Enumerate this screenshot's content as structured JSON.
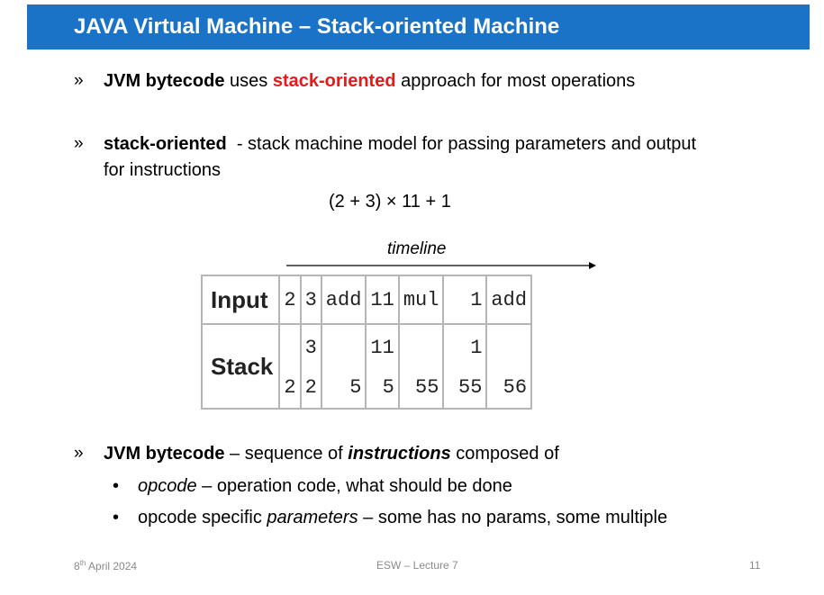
{
  "slide": {
    "title": "JAVA Virtual Machine – Stack-oriented Machine",
    "bullet_mark": "»",
    "sub_mark": "•",
    "bullet1": {
      "b1": "JVM bytecode",
      "t1": " uses ",
      "r1": "stack-oriented",
      "t2": " approach for most operations"
    },
    "bullet2": {
      "b1": "stack-oriented",
      "t1": "  - stack machine model for passing parameters and output",
      "line2": "for instructions"
    },
    "formula": "(2 + 3) × 11 + 1",
    "figure": {
      "timeline_label": "timeline",
      "row_input_label": "Input",
      "row_stack_label": "Stack",
      "columns": [
        {
          "input": "2",
          "stack_top": "",
          "stack_bottom": "2"
        },
        {
          "input": "3",
          "stack_top": "3",
          "stack_bottom": "2"
        },
        {
          "input": "add",
          "stack_top": "",
          "stack_bottom": "5"
        },
        {
          "input": "11",
          "stack_top": "11",
          "stack_bottom": "5"
        },
        {
          "input": "mul",
          "stack_top": "",
          "stack_bottom": "55"
        },
        {
          "input": "1",
          "stack_top": "1",
          "stack_bottom": "55"
        },
        {
          "input": "add",
          "stack_top": "",
          "stack_bottom": "56"
        }
      ]
    },
    "bullet3": {
      "b1": "JVM bytecode",
      "t1": " – sequence of ",
      "bi1": "instructions",
      "t2": " composed of"
    },
    "sub1": {
      "i1": "opcode",
      "t1": " – operation code, what should be done"
    },
    "sub2": {
      "t1": "opcode specific ",
      "i1": "parameters",
      "t2": " – some has no params, some multiple"
    },
    "footer": {
      "date_day": "8",
      "date_sup": "th",
      "date_rest": " April 2024",
      "center": "ESW – Lecture 7",
      "page": "11"
    }
  },
  "colors": {
    "title_bar": "#1a73c6",
    "highlight_red": "#e21b1b"
  }
}
